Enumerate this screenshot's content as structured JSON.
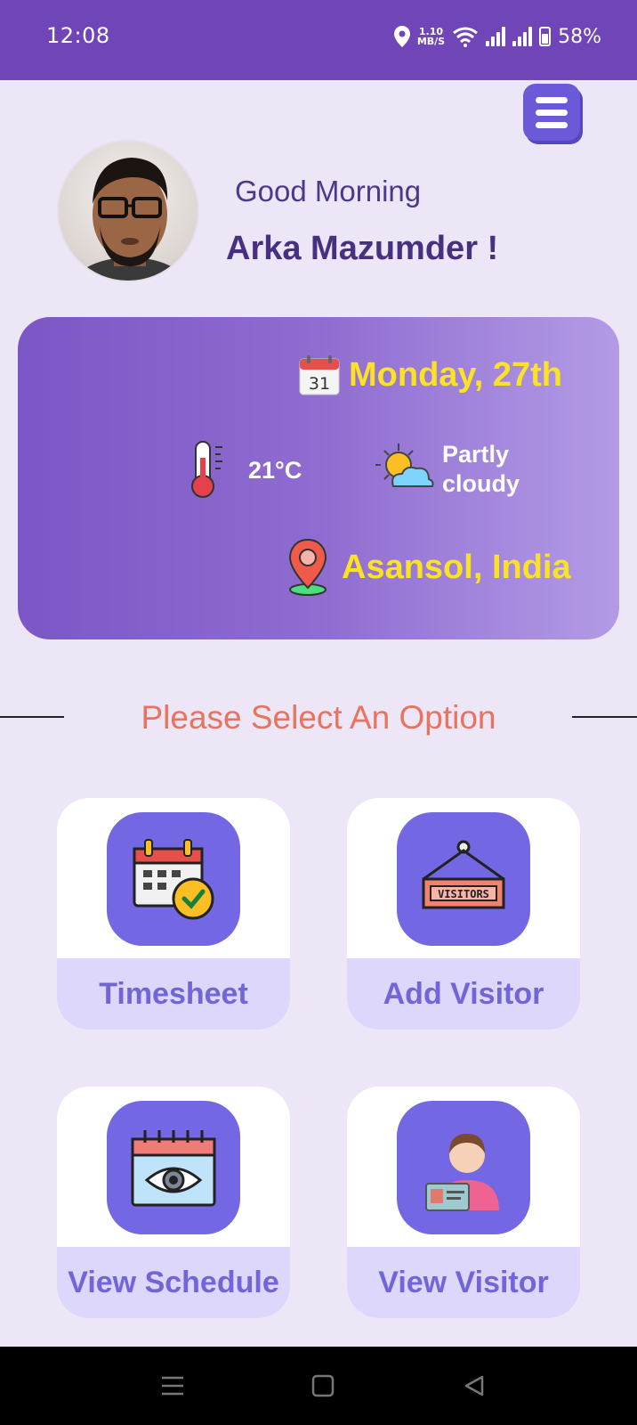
{
  "status_bar": {
    "time": "12:08",
    "net_speed_value": "1.10",
    "net_speed_unit": "MB/S",
    "battery": "58%",
    "icons": [
      "location-icon",
      "wifi-icon",
      "signal-icon",
      "signal-icon",
      "battery-icon"
    ]
  },
  "header": {
    "menu_icon": "hamburger-menu-icon",
    "greeting": "Good Morning",
    "username": "Arka Mazumder !"
  },
  "weather": {
    "date": "Monday, 27th",
    "temperature": "21°C",
    "condition": "Partly cloudy",
    "location": "Asansol, India",
    "colors": {
      "highlight": "#fce224",
      "card_start": "#7b57c6",
      "card_end": "#b39be6"
    }
  },
  "options": {
    "title": "Please Select An Option",
    "items": [
      {
        "label": "Timesheet",
        "icon": "calendar-check-icon"
      },
      {
        "label": "Add Visitor",
        "icon": "visitors-sign-icon"
      },
      {
        "label": "View Schedule",
        "icon": "calendar-eye-icon"
      },
      {
        "label": "View Visitor",
        "icon": "person-id-card-icon"
      }
    ]
  },
  "nav_bar": {
    "icons": [
      "recent-apps-icon",
      "home-icon",
      "back-icon"
    ]
  }
}
